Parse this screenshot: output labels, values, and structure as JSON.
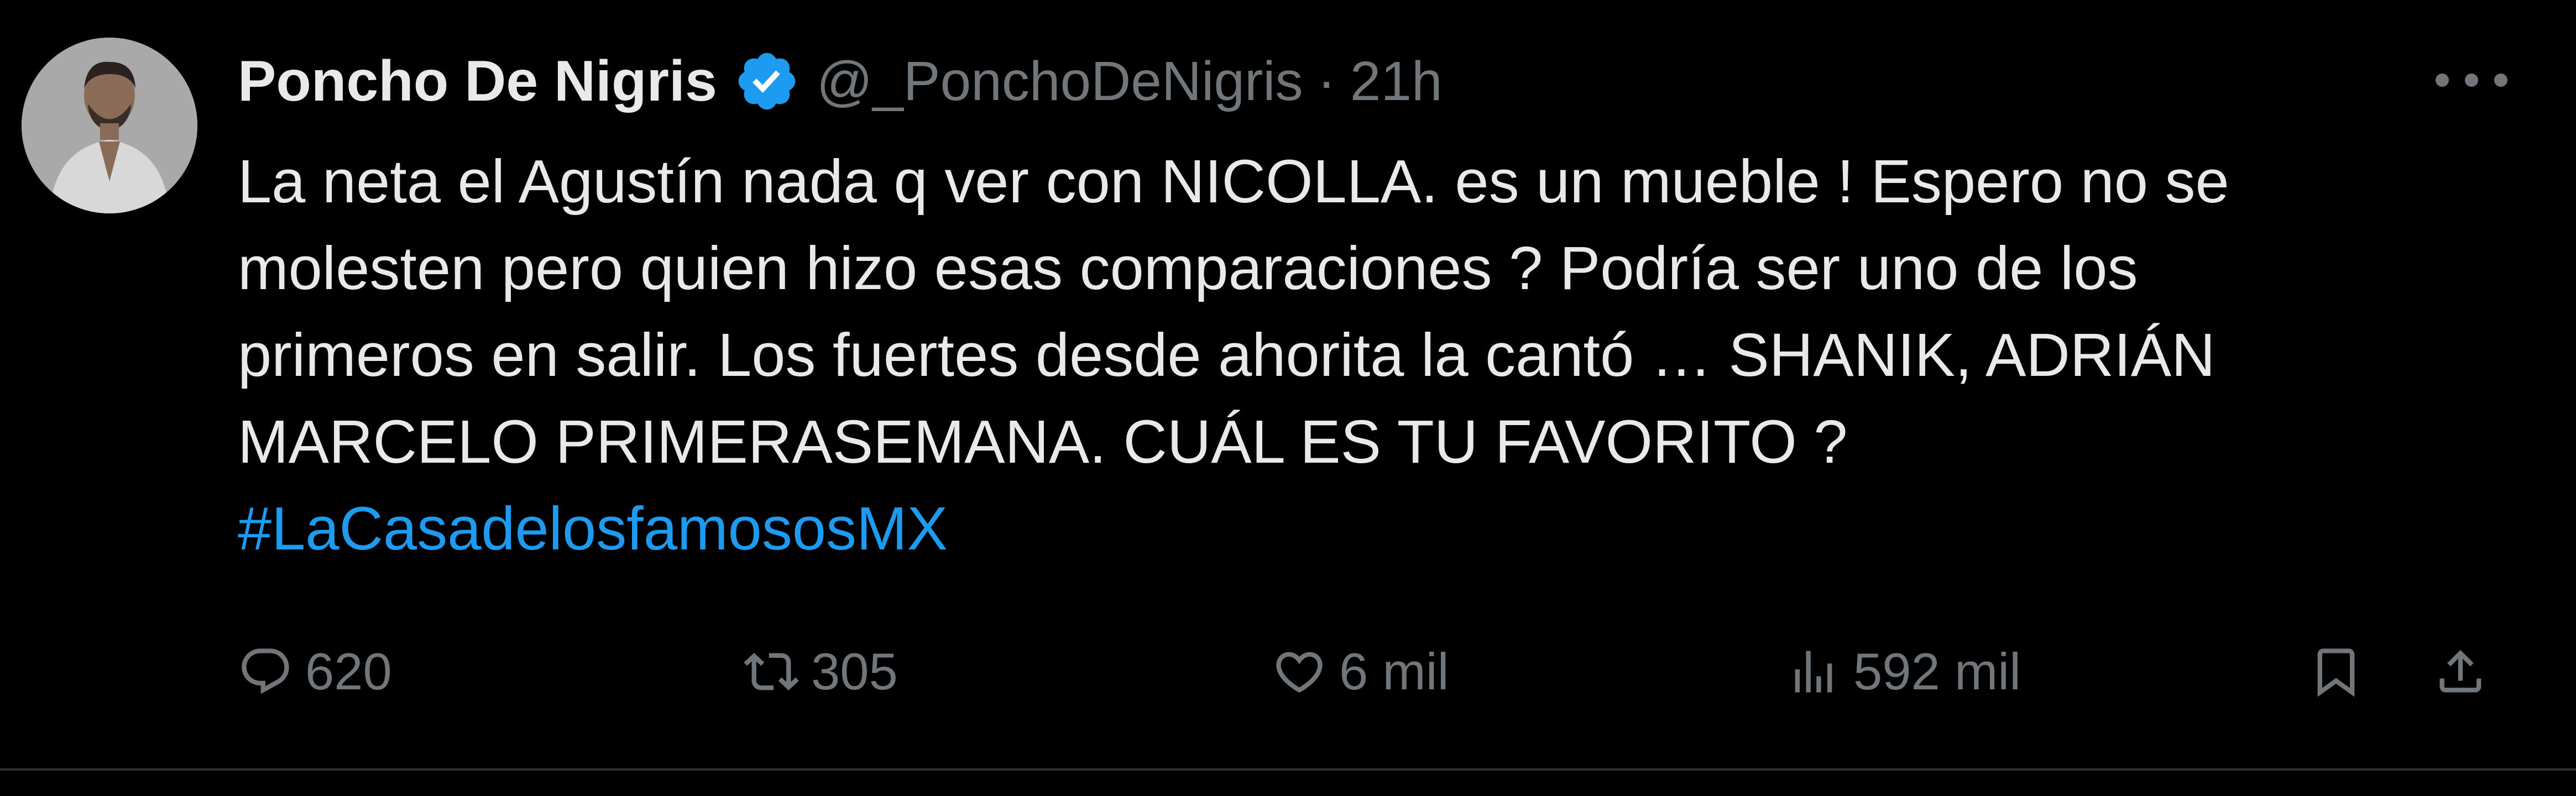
{
  "tweet": {
    "author": {
      "name": "Poncho De Nigris",
      "handle": "@_PonchoDeNigris",
      "verified": true,
      "avatar_icon": "avatar"
    },
    "separator": "·",
    "time": "21h",
    "text_lines": [
      "La neta el Agustín nada q ver con NICOLLA. es un mueble ! Espero no se",
      "molesten pero quien hizo esas comparaciones ? Podría ser uno de los",
      "primeros en salir. Los fuertes desde ahorita la cantó … SHANIK, ADRIÁN",
      "MARCELO PRIMERASEMANA. CUÁL  ES TU FAVORITO ?"
    ],
    "hashtag": "#LaCasadelosfamososMX",
    "stats": {
      "replies": "620",
      "retweets": "305",
      "likes": "6 mil",
      "views": "592 mil"
    }
  },
  "colors": {
    "background": "#000000",
    "text": "#e7e9ea",
    "muted": "#71767b",
    "link": "#1d9bf0",
    "verified": "#1d9bf0",
    "divider": "#2f3336"
  },
  "icons": [
    "more-icon",
    "verified-badge-icon",
    "reply-icon",
    "retweet-icon",
    "like-icon",
    "views-icon",
    "bookmark-icon",
    "share-icon"
  ]
}
